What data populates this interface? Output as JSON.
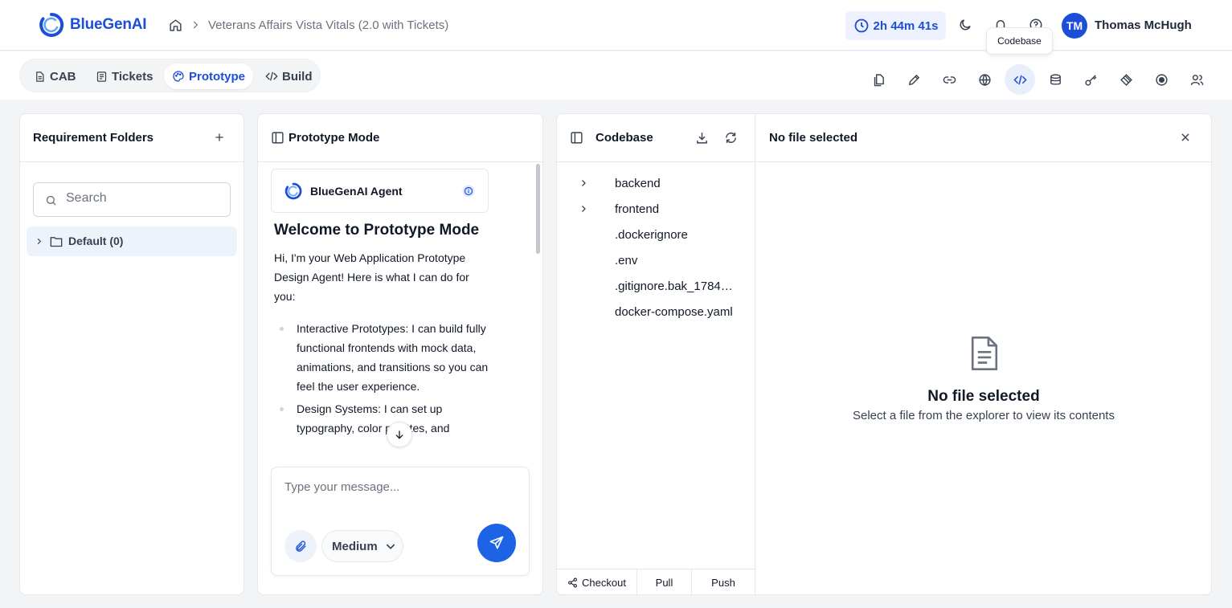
{
  "app": {
    "name": "BlueGenAI",
    "accent": "#1d4ed8"
  },
  "breadcrumb": {
    "project": "Veterans Affairs Vista Vitals (2.0 with Tickets)"
  },
  "header": {
    "timer": "2h 44m 41s",
    "user_initials": "TM",
    "user_name": "Thomas McHugh",
    "tooltip": "Codebase"
  },
  "mode_tabs": [
    {
      "label": "CAB",
      "icon": "document-icon",
      "active": false
    },
    {
      "label": "Tickets",
      "icon": "list-icon",
      "active": false
    },
    {
      "label": "Prototype",
      "icon": "palette-icon",
      "active": true
    },
    {
      "label": "Build",
      "icon": "code-icon",
      "active": false
    }
  ],
  "toolbar": [
    "files-icon",
    "pen-icon",
    "link-icon",
    "globe-icon",
    "code-icon",
    "database-icon",
    "key-icon",
    "layers-icon",
    "record-icon",
    "users-icon"
  ],
  "requirements": {
    "title": "Requirement Folders",
    "search_placeholder": "Search",
    "folders": [
      {
        "label": "Default (0)"
      }
    ]
  },
  "chat": {
    "title": "Prototype Mode",
    "agent_name": "BlueGenAI Agent",
    "welcome_title": "Welcome to Prototype Mode",
    "intro": "Hi, I'm your Web Application Prototype Design Agent! Here is what I can do for you:",
    "bullets": [
      "Interactive Prototypes: I can build fully functional frontends with mock data, animations, and transitions so you can feel the user experience.",
      "Design Systems: I can set up typography, color palettes, and"
    ],
    "input_placeholder": "Type your message...",
    "effort": "Medium"
  },
  "codebase": {
    "title": "Codebase",
    "tree": [
      {
        "name": "backend",
        "type": "folder"
      },
      {
        "name": "frontend",
        "type": "folder"
      },
      {
        "name": ".dockerignore",
        "type": "file"
      },
      {
        "name": ".env",
        "type": "file"
      },
      {
        "name": ".gitignore.bak_17847...",
        "type": "file"
      },
      {
        "name": "docker-compose.yaml",
        "type": "file"
      }
    ],
    "git": {
      "checkout": "Checkout",
      "pull": "Pull",
      "push": "Push"
    }
  },
  "viewer": {
    "header": "No file selected",
    "empty_title": "No file selected",
    "empty_subtitle": "Select a file from the explorer to view its contents"
  }
}
